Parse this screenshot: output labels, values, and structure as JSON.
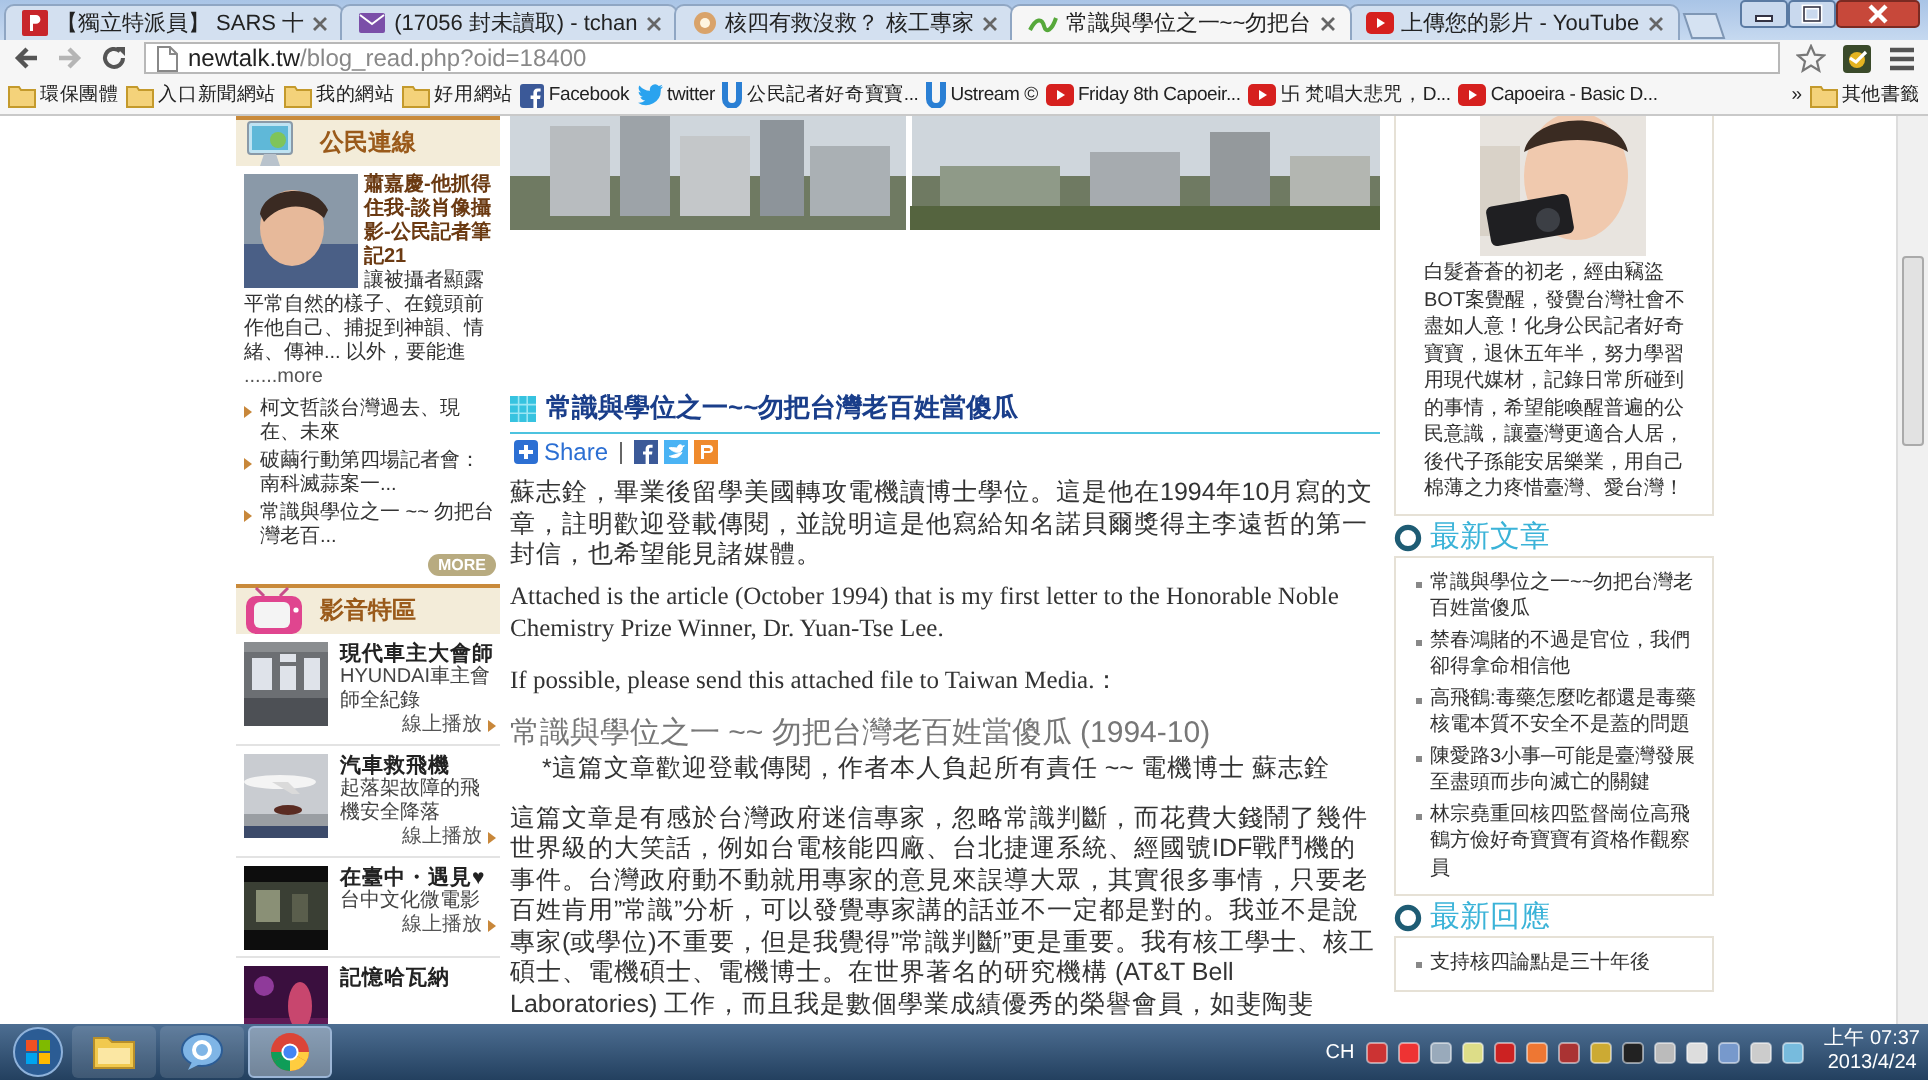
{
  "browser": {
    "tabs": [
      {
        "kind": "news",
        "title": "【獨立特派員】 SARS 十",
        "selected": false
      },
      {
        "kind": "mail",
        "title": "(17056 封未讀取) - tchan",
        "selected": false
      },
      {
        "kind": "page",
        "title": "核四有救沒救？ 核工專家",
        "selected": false
      },
      {
        "kind": "blog",
        "title": "常識與學位之一~~勿把台",
        "selected": true
      },
      {
        "kind": "youtube",
        "title": "上傳您的影片 - YouTube",
        "selected": false
      }
    ],
    "address": {
      "host": "newtalk.tw",
      "path": "/blog_read.php?oid=18400"
    },
    "bookmarks": [
      {
        "kind": "folder",
        "label": "環保團體"
      },
      {
        "kind": "folder",
        "label": "入口新聞網站"
      },
      {
        "kind": "folder",
        "label": "我的網站"
      },
      {
        "kind": "folder",
        "label": "好用網站"
      },
      {
        "kind": "facebook",
        "label": "Facebook"
      },
      {
        "kind": "twitter",
        "label": "twitter"
      },
      {
        "kind": "ustream",
        "label": "公民記者好奇寶寶..."
      },
      {
        "kind": "ustream",
        "label": "Ustream ©"
      },
      {
        "kind": "youtube",
        "label": "Friday 8th Capoeir..."
      },
      {
        "kind": "youtube",
        "label": "卐 梵唱大悲咒，D..."
      },
      {
        "kind": "youtube",
        "label": "Capoeira - Basic D..."
      }
    ],
    "overflow": "»",
    "other_bookmarks": "其他書籤"
  },
  "left_sidebar": {
    "citizen": {
      "heading": "公民連線",
      "feature": {
        "title": "蕭嘉慶-他抓得住我-談肖像攝影-公民記者筆記21",
        "summary": "讓被攝者顯露平常自然的樣子、在鏡頭前作他自己、捕捉到神韻、情緒、傳神... 以外，要能進",
        "more": "......more"
      },
      "links": [
        "柯文哲談台灣過去、現在、未來",
        "破繭行動第四場記者會：南科滅蒜案一...",
        "常識與學位之一 ~~ 勿把台灣老百..."
      ],
      "more_button": "MORE"
    },
    "video": {
      "heading": "影音特區",
      "items": [
        {
          "kind": "crowd",
          "title": "現代車主大會師",
          "description": "HYUNDAI車主會師全紀錄",
          "play": "線上播放"
        },
        {
          "kind": "plane",
          "title": "汽車救飛機",
          "description": "起落架故障的飛機安全降落",
          "play": "線上播放"
        },
        {
          "kind": "room",
          "title": "在臺中・遇見♥",
          "description": "台中文化微電影",
          "play": "線上播放"
        },
        {
          "kind": "concert",
          "title": "記憶哈瓦納"
        }
      ]
    }
  },
  "article": {
    "title": "常識與學位之一~~勿把台灣老百姓當傻瓜",
    "share": "Share",
    "paragraphs": [
      {
        "kind": "cjk",
        "text": "蘇志銓，畢業後留學美國轉攻電機讀博士學位。這是他在1994年10月寫的文章，註明歡迎登載傳閱，並說明這是他寫給知名諾貝爾獎得主李遠哲的第一封信，也希望能見諸媒體。"
      },
      {
        "kind": "latin",
        "text": "Attached is the article (October 1994) that is my first letter to the Honorable Noble Chemistry Prize Winner, Dr. Yuan-Tse Lee."
      },
      {
        "kind": "latin",
        "text": "If possible, please send this attached file to Taiwan Media.："
      },
      {
        "kind": "heading",
        "text": "常識與學位之一 ~~ 勿把台灣老百姓當傻瓜 (1994-10)"
      },
      {
        "kind": "note",
        "text": "*這篇文章歡迎登載傳閱，作者本人負起所有責任 ~~ 電機博士 蘇志銓"
      },
      {
        "kind": "cjk",
        "text": "這篇文章是有感於台灣政府迷信專家，忽略常識判斷，而花費大錢鬧了幾件世界級的大笑話，例如台電核能四廠、台北捷運系統、經國號IDF戰鬥機的事件。台灣政府動不動就用專家的意見來誤導大眾，其實很多事情，只要老百姓肯用”常識”分析，可以發覺專家講的話並不一定都是對的。我並不是說專家(或學位)不重要，但是我覺得”常識判斷”更是重要。我有核工學士、核工碩士、電機碩士、電機博士。在世界著名的研究機構 (AT&T Bell Laboratories) 工作，而且我是數個學業成績優秀的榮譽會員，如斐陶斐"
      }
    ]
  },
  "right_sidebar": {
    "bio": "白髮蒼蒼的初老，經由竊盜BOT案覺醒，發覺台灣社會不盡如人意！化身公民記者好奇寶寶，退休五年半，努力學習用現代媒材，記錄日常所碰到的事情，希望能喚醒普遍的公民意識，讓臺灣更適合人居，後代子孫能安居樂業，用自己棉薄之力疼惜臺灣、愛台灣！",
    "latest_posts": {
      "heading": "最新文章",
      "items": [
        "常識與學位之一~~勿把台灣老百姓當傻瓜",
        "禁春鴻賭的不過是官位，我們卻得拿命相信他",
        "高飛鶴:毒藥怎麼吃都還是毒藥核電本質不安全不是蓋的問題",
        "陳愛路3小事─可能是臺灣發展至盡頭而步向滅亡的關鍵",
        "林宗堯重回核四監督崗位高飛鶴方儉好奇寶寶有資格作觀察員"
      ]
    },
    "latest_replies": {
      "heading": "最新回應",
      "items": [
        "支持核四論點是三十年後"
      ]
    }
  },
  "taskbar": {
    "apps": [
      {
        "kind": "explorer",
        "selected": false
      },
      {
        "kind": "messenger",
        "selected": false
      },
      {
        "kind": "chrome",
        "selected": true
      }
    ],
    "ime": "CH",
    "time": "上午 07:37",
    "date": "2013/4/24"
  }
}
